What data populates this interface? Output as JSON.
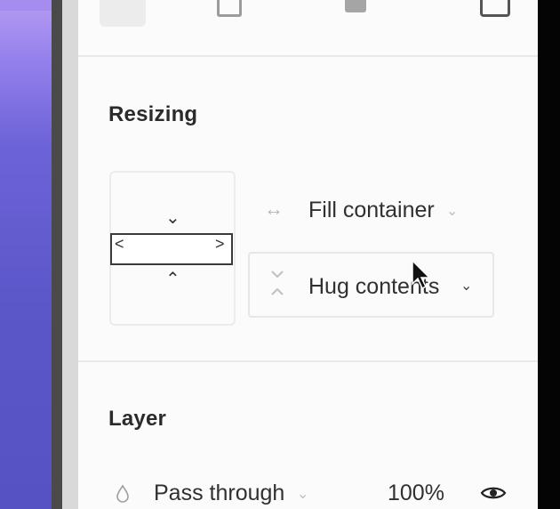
{
  "resizing": {
    "title": "Resizing",
    "width_mode": "Fill container",
    "height_mode": "Hug contents"
  },
  "layer": {
    "title": "Layer",
    "blend_mode": "Pass through",
    "opacity": "100%"
  },
  "icons": {
    "width_icon": "horizontal-arrows-icon",
    "height_icon": "vertical-collapse-icon",
    "blend_icon": "drop-icon",
    "visibility_icon": "eye-icon"
  }
}
